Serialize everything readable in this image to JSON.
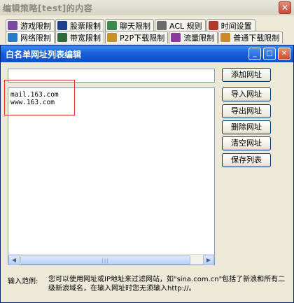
{
  "parent_window": {
    "title": "编辑策略[test]的内容",
    "close_glyph": "✕",
    "tabs_row1": [
      {
        "label": "游戏限制",
        "icon": "game-icon",
        "color": "#7a4aa0"
      },
      {
        "label": "股票限制",
        "icon": "stock-icon",
        "color": "#1d3f8f"
      },
      {
        "label": "聊天限制",
        "icon": "chat-icon",
        "color": "#3a8a4a"
      },
      {
        "label": "ACL 规则",
        "icon": "acl-icon",
        "color": "#6b6b6b"
      },
      {
        "label": "时间设置",
        "icon": "clock-icon",
        "color": "#b23a2a"
      }
    ],
    "tabs_row2": [
      {
        "label": "网络限制",
        "icon": "network-icon",
        "color": "#2b7ac9"
      },
      {
        "label": "带宽限制",
        "icon": "bandwidth-icon",
        "color": "#2f6a3a"
      },
      {
        "label": "P2P下载限制",
        "icon": "p2p-icon",
        "color": "#c7902a"
      },
      {
        "label": "流量限制",
        "icon": "traffic-icon",
        "color": "#8a3a9a"
      },
      {
        "label": "普通下载限制",
        "icon": "download-icon",
        "color": "#c98a2a"
      }
    ]
  },
  "dialog": {
    "title": "白名单网址列表编辑",
    "minimize_glyph": "_",
    "maximize_glyph": "□",
    "close_glyph": "✕",
    "url_input_value": "",
    "list_entries": [
      "mail.163.com",
      "www.163.com"
    ],
    "scroll_left": "◀",
    "scroll_right": "▶",
    "scroll_grip": "|||",
    "buttons": {
      "add": "添加网址",
      "import": "导入网址",
      "export": "导出网址",
      "delete": "删除网址",
      "clear": "清空网址",
      "save": "保存列表"
    },
    "hint_label": "输入范例:",
    "hint_text": "您可以使用网址或IP地址来过滤网站，如\"sina.com.cn\"包括了新浪和所有二级新浪域名，在输入网址时您无须输入http://。"
  }
}
